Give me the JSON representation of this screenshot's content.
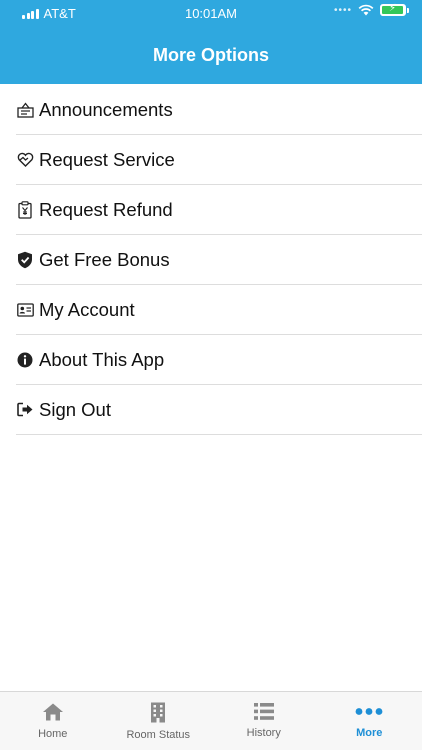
{
  "status_bar": {
    "carrier": "AT&T",
    "time": "10:01AM"
  },
  "header": {
    "title": "More Options"
  },
  "menu": [
    {
      "label": "Announcements",
      "icon": "announcement-icon"
    },
    {
      "label": "Request Service",
      "icon": "service-heart-icon"
    },
    {
      "label": "Request Refund",
      "icon": "refund-clipboard-icon"
    },
    {
      "label": "Get Free Bonus",
      "icon": "shield-check-icon"
    },
    {
      "label": "My Account",
      "icon": "id-card-icon"
    },
    {
      "label": "About This App",
      "icon": "info-icon"
    },
    {
      "label": "Sign Out",
      "icon": "sign-out-icon"
    }
  ],
  "tabbar": {
    "tabs": [
      {
        "label": "Home",
        "icon": "home-icon"
      },
      {
        "label": "Room Status",
        "icon": "building-icon"
      },
      {
        "label": "History",
        "icon": "list-icon"
      },
      {
        "label": "More",
        "icon": "more-dots-icon"
      }
    ],
    "active_index": 3
  },
  "colors": {
    "header_bg": "#2fa8df",
    "active_tab": "#1e8fd6",
    "inactive_tab": "#666666",
    "battery": "#35c759"
  }
}
